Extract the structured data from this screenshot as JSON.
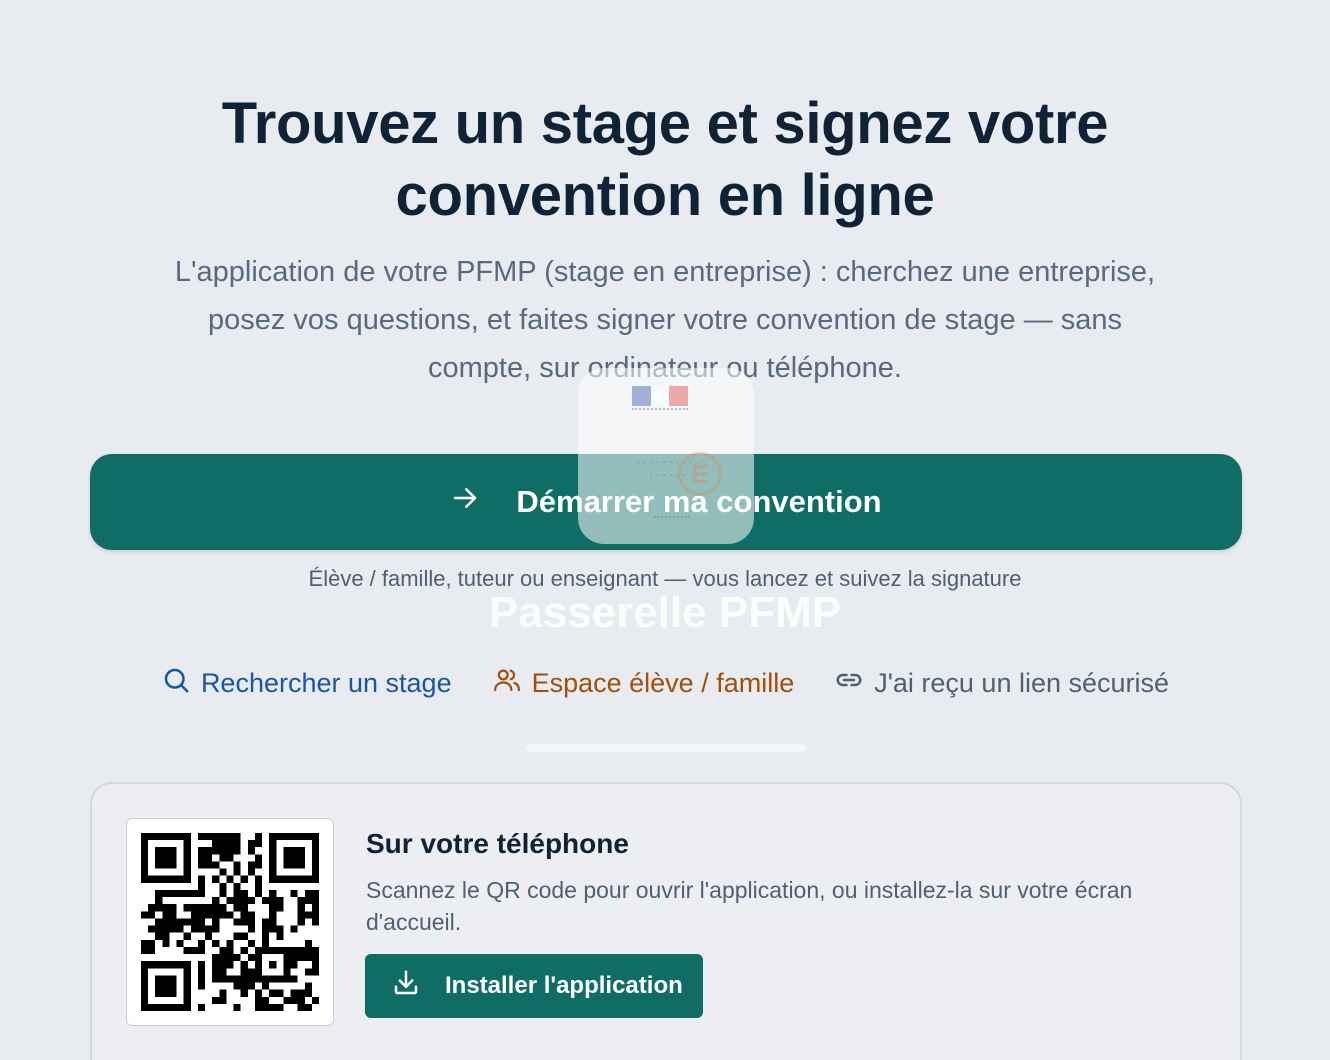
{
  "hero": {
    "title_line1": "Trouvez un stage et signez votre",
    "title_line2": "convention en ligne",
    "subtitle_line1": "L'application de votre PFMP (stage en entreprise) : cherchez une entreprise,",
    "subtitle_line2": "posez vos questions, et faites signer votre convention de stage — sans",
    "subtitle_line3": "compte, sur ordinateur ou téléphone."
  },
  "cta": {
    "label": "Démarrer ma convention",
    "icon": "arrow-right-icon",
    "hint": "Élève / famille, tuteur ou enseignant — vous lancez et suivez la signature"
  },
  "splash": {
    "app_name": "Passerelle PFMP"
  },
  "links": [
    {
      "label": "Rechercher un stage",
      "icon": "search-icon",
      "color": "#1a55a8"
    },
    {
      "label": "Espace élève / famille",
      "icon": "users-icon",
      "color": "#a54e0b"
    },
    {
      "label": "J'ai reçu un lien sécurisé",
      "icon": "link-icon",
      "color": "#4f6074"
    }
  ],
  "phone_card": {
    "title": "Sur votre téléphone",
    "description": "Scannez le QR code pour ouvrir l'application, ou installez-la sur votre écran d'accueil.",
    "install_label": "Installer l'application",
    "install_icon": "download-icon"
  },
  "colors": {
    "background": "#e8ebef",
    "primary": "#0f6d66",
    "heading": "#0f2236",
    "muted": "#5a6a7e",
    "link_blue": "#1a55a8",
    "link_orange": "#a54e0b"
  }
}
